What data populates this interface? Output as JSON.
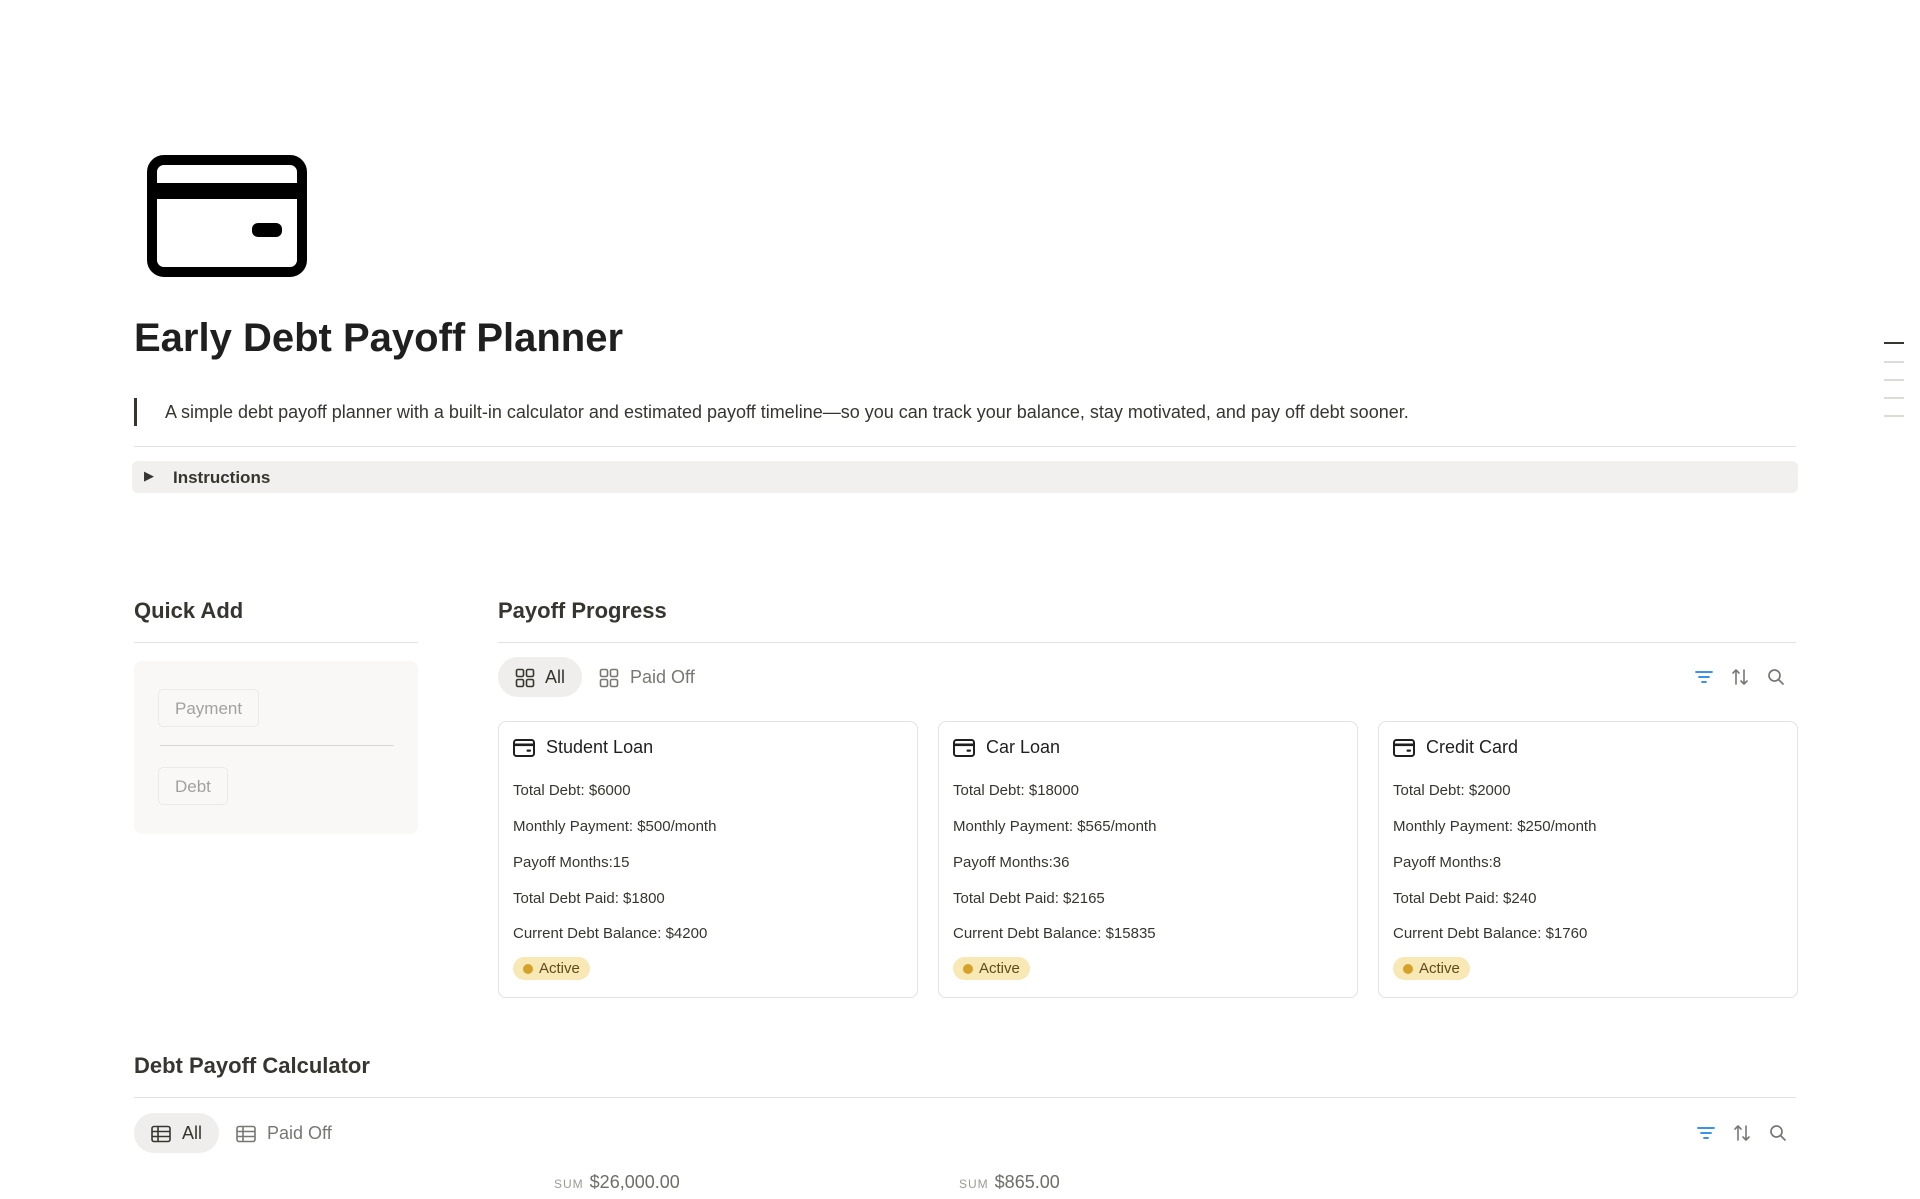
{
  "page": {
    "icon": "credit-card-icon",
    "title": "Early Debt Payoff Planner",
    "description": "A simple debt payoff planner with a built-in calculator and estimated payoff timeline—so you can track your balance, stay motivated, and pay off debt sooner."
  },
  "instructions": {
    "label": "Instructions",
    "icon": "triangle-right-icon"
  },
  "quick_add": {
    "title": "Quick Add",
    "buttons": [
      "Payment",
      "Debt"
    ]
  },
  "payoff_progress": {
    "title": "Payoff Progress",
    "tabs": [
      {
        "label": "All",
        "icon": "gallery-icon",
        "active": true
      },
      {
        "label": "Paid Off",
        "icon": "gallery-icon",
        "active": false
      }
    ],
    "tools": [
      "filter-icon",
      "sort-icon",
      "search-icon"
    ],
    "cards": [
      {
        "title": "Student Loan",
        "icon": "credit-card-icon",
        "total_debt": "Total Debt: $6000",
        "monthly_payment": "Monthly Payment: $500/month",
        "payoff_months": "Payoff Months:15",
        "total_paid": "Total Debt Paid: $1800",
        "current_balance": "Current Debt Balance: $4200",
        "status": "Active"
      },
      {
        "title": "Car Loan",
        "icon": "credit-card-icon",
        "total_debt": "Total Debt: $18000",
        "monthly_payment": "Monthly Payment: $565/month",
        "payoff_months": "Payoff Months:36",
        "total_paid": "Total Debt Paid: $2165",
        "current_balance": "Current Debt Balance: $15835",
        "status": "Active"
      },
      {
        "title": "Credit Card",
        "icon": "credit-card-icon",
        "total_debt": "Total Debt: $2000",
        "monthly_payment": "Monthly Payment: $250/month",
        "payoff_months": "Payoff Months:8",
        "total_paid": "Total Debt Paid: $240",
        "current_balance": "Current Debt Balance: $1760",
        "status": "Active"
      }
    ]
  },
  "calculator": {
    "title": "Debt Payoff Calculator",
    "tabs": [
      {
        "label": "All",
        "icon": "table-icon",
        "active": true
      },
      {
        "label": "Paid Off",
        "icon": "table-icon",
        "active": false
      }
    ],
    "tools": [
      "filter-icon",
      "sort-icon",
      "search-icon"
    ],
    "sums": [
      {
        "label": "SUM",
        "value": "$26,000.00"
      },
      {
        "label": "SUM",
        "value": "$865.00"
      }
    ]
  },
  "colors": {
    "text": "#37352f",
    "accent_blue": "#2383e2",
    "status_active_bg": "#f7e8b6",
    "status_active_dot": "#d6a128",
    "toggle_bg": "#f1f0ee",
    "quick_add_bg": "#f9f8f7"
  }
}
